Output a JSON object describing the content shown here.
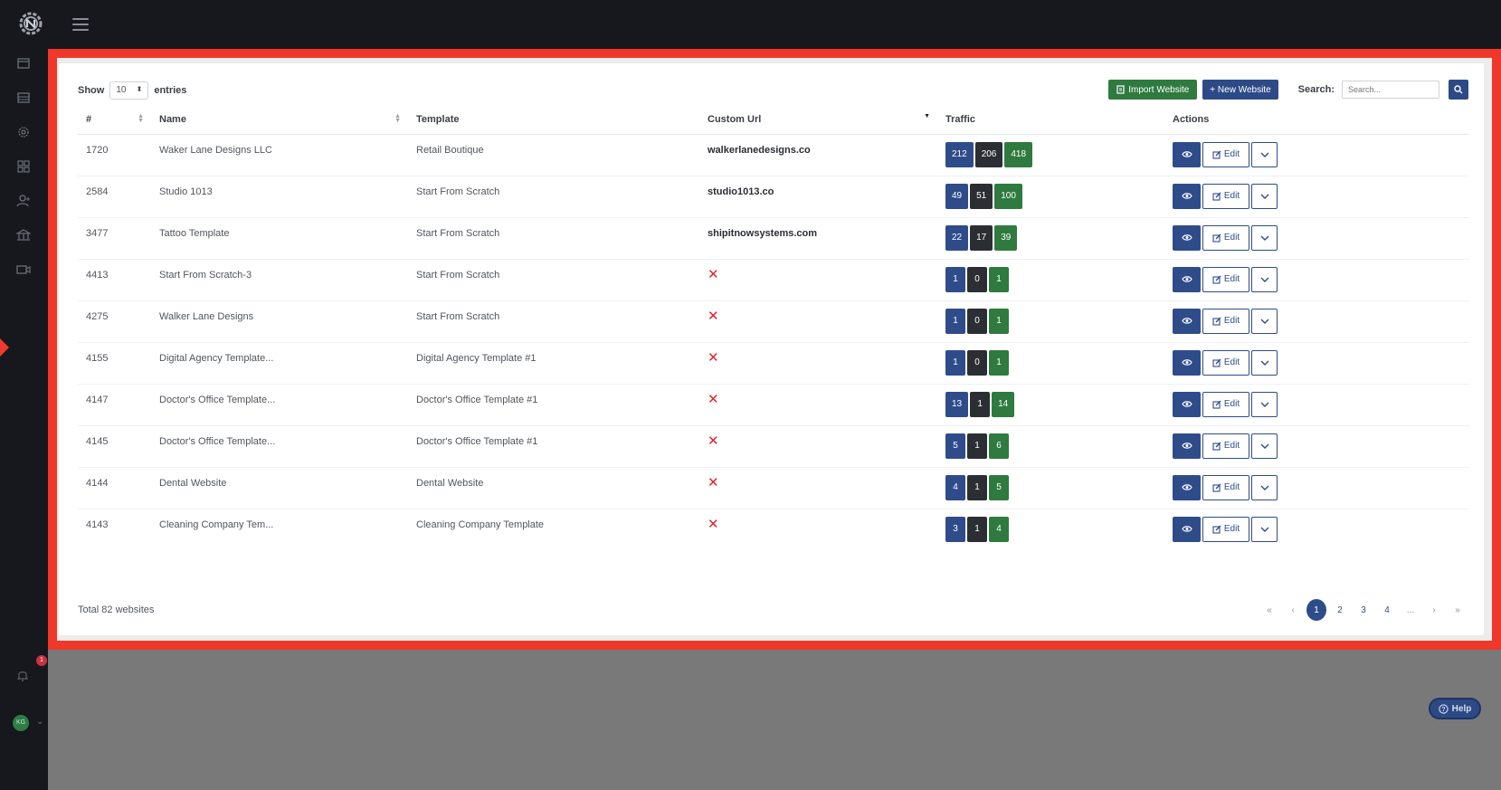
{
  "sidebar": {
    "icons": [
      "browser-window-icon",
      "list-icon",
      "gear-icon",
      "apps-icon",
      "add-user-icon",
      "bank-icon",
      "video-icon"
    ],
    "notification_count": "1",
    "avatar_initials": "KG"
  },
  "toolbar": {
    "show_label": "Show",
    "entries_value": "10",
    "entries_label": "entries",
    "import_label": "Import Website",
    "new_label": "+ New Website",
    "search_label": "Search:",
    "search_placeholder": "Search..."
  },
  "table": {
    "headers": [
      "#",
      "Name",
      "Template",
      "Custom Url",
      "Traffic",
      "Actions"
    ],
    "edit_label": "Edit",
    "rows": [
      {
        "id": "1720",
        "name": "Waker Lane Designs LLC",
        "template": "Retail Boutique",
        "url": "walkerlanedesigns.co",
        "traffic": [
          "212",
          "206",
          "418"
        ]
      },
      {
        "id": "2584",
        "name": "Studio 1013",
        "template": "Start From Scratch",
        "url": "studio1013.co",
        "traffic": [
          "49",
          "51",
          "100"
        ]
      },
      {
        "id": "3477",
        "name": "Tattoo Template",
        "template": "Start From Scratch",
        "url": "shipitnowsystems.com",
        "traffic": [
          "22",
          "17",
          "39"
        ]
      },
      {
        "id": "4413",
        "name": "Start From Scratch-3",
        "template": "Start From Scratch",
        "url": "",
        "traffic": [
          "1",
          "0",
          "1"
        ]
      },
      {
        "id": "4275",
        "name": "Walker Lane Designs",
        "template": "Start From Scratch",
        "url": "",
        "traffic": [
          "1",
          "0",
          "1"
        ]
      },
      {
        "id": "4155",
        "name": "Digital Agency Template...",
        "template": "Digital Agency Template #1",
        "url": "",
        "traffic": [
          "1",
          "0",
          "1"
        ]
      },
      {
        "id": "4147",
        "name": "Doctor's Office Template...",
        "template": "Doctor's Office Template #1",
        "url": "",
        "traffic": [
          "13",
          "1",
          "14"
        ]
      },
      {
        "id": "4145",
        "name": "Doctor's Office Template...",
        "template": "Doctor's Office Template #1",
        "url": "",
        "traffic": [
          "5",
          "1",
          "6"
        ]
      },
      {
        "id": "4144",
        "name": "Dental Website",
        "template": "Dental Website",
        "url": "",
        "traffic": [
          "4",
          "1",
          "5"
        ]
      },
      {
        "id": "4143",
        "name": "Cleaning Company Tem...",
        "template": "Cleaning Company Template",
        "url": "",
        "traffic": [
          "3",
          "1",
          "4"
        ]
      }
    ]
  },
  "footer": {
    "total": "Total 82 websites",
    "pages": [
      "«",
      "‹",
      "1",
      "2",
      "3",
      "4",
      "...",
      "›",
      "»"
    ],
    "active_page": "1"
  },
  "help": {
    "label": "Help"
  },
  "colors": {
    "accent": "#2f4c8a",
    "success": "#2f7a3e",
    "dark": "#2b2e33",
    "danger": "#e0242a",
    "highlight": "#f0382a"
  }
}
